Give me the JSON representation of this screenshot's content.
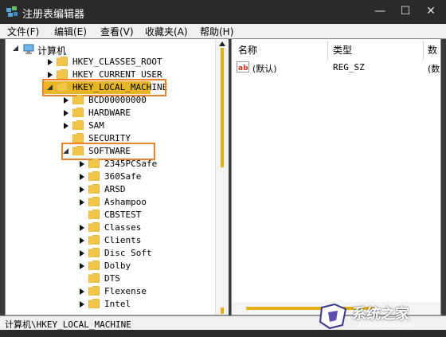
{
  "window": {
    "title": "注册表编辑器",
    "controls": {
      "minimize": "—",
      "maximize": "☐",
      "close": "✕"
    }
  },
  "menu": [
    "文件(F)",
    "编辑(E)",
    "查看(V)",
    "收藏夹(A)",
    "帮助(H)"
  ],
  "tree": {
    "root": "计算机",
    "items": [
      {
        "label": "HKEY_CLASSES_ROOT",
        "state": "collapsed",
        "indent": 1
      },
      {
        "label": "HKEY_CURRENT_USER",
        "state": "collapsed",
        "indent": 1
      },
      {
        "label": "HKEY_LOCAL_MACHINE",
        "state": "expanded",
        "indent": 1,
        "selected": true,
        "highlighted": true
      },
      {
        "label": "BCD00000000",
        "state": "collapsed",
        "indent": 2
      },
      {
        "label": "HARDWARE",
        "state": "collapsed",
        "indent": 2
      },
      {
        "label": "SAM",
        "state": "collapsed",
        "indent": 2
      },
      {
        "label": "SECURITY",
        "state": "none",
        "indent": 2
      },
      {
        "label": "SOFTWARE",
        "state": "expanded",
        "indent": 2,
        "highlighted": true
      },
      {
        "label": "2345PCSafe",
        "state": "collapsed",
        "indent": 3
      },
      {
        "label": "360Safe",
        "state": "collapsed",
        "indent": 3
      },
      {
        "label": "ARSD",
        "state": "collapsed",
        "indent": 3
      },
      {
        "label": "Ashampoo",
        "state": "collapsed",
        "indent": 3
      },
      {
        "label": "CBSTEST",
        "state": "none",
        "indent": 3
      },
      {
        "label": "Classes",
        "state": "collapsed",
        "indent": 3
      },
      {
        "label": "Clients",
        "state": "collapsed",
        "indent": 3
      },
      {
        "label": "Disc Soft",
        "state": "collapsed",
        "indent": 3
      },
      {
        "label": "Dolby",
        "state": "collapsed",
        "indent": 3
      },
      {
        "label": "DTS",
        "state": "none",
        "indent": 3
      },
      {
        "label": "Flexense",
        "state": "collapsed",
        "indent": 3
      },
      {
        "label": "Intel",
        "state": "collapsed",
        "indent": 3
      }
    ]
  },
  "list": {
    "columns": [
      "名称",
      "类型",
      "数"
    ],
    "rows": [
      {
        "name": "(默认)",
        "type": "REG_SZ",
        "data": "(数"
      }
    ]
  },
  "status": {
    "path": "计算机\\HKEY_LOCAL_MACHINE"
  },
  "watermark": {
    "text": "系统之家",
    "url": "XITONGZHIJIA.NET"
  },
  "colors": {
    "accent": "#e8b824",
    "highlight_box": "#f0812c",
    "folder": "#f3c64b",
    "titlebar": "#2b2b2b"
  }
}
